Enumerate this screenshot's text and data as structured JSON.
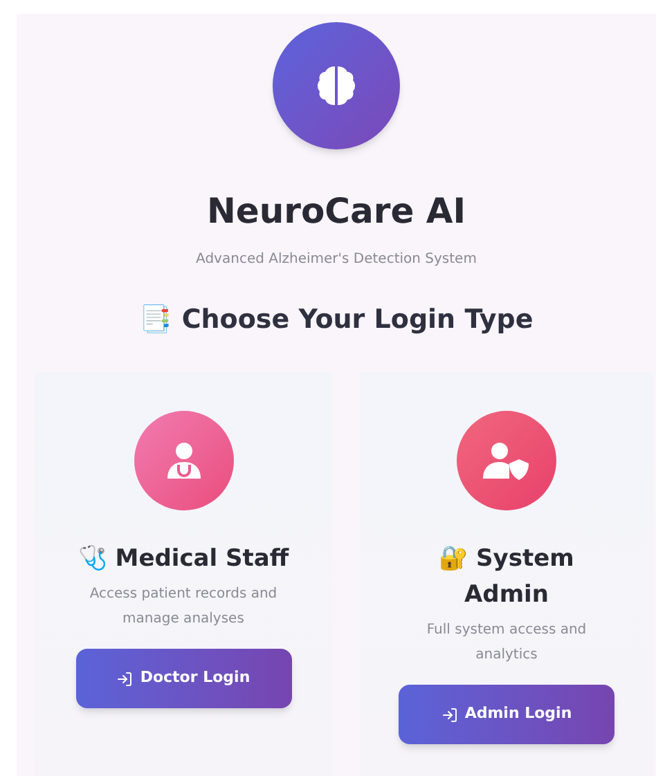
{
  "app": {
    "title": "NeuroCare AI",
    "subtitle": "Advanced Alzheimer's Detection System"
  },
  "heading": {
    "emoji": "📑",
    "text": "Choose Your Login Type"
  },
  "cards": [
    {
      "kind": "doctor",
      "emoji": "🩺",
      "title": "Medical Staff",
      "description": "Access patient records and manage analyses",
      "button": "Doctor Login"
    },
    {
      "kind": "admin",
      "emoji": "🔐",
      "title": "System Admin",
      "description": "Full system access and analytics",
      "button": "Admin Login"
    }
  ]
}
